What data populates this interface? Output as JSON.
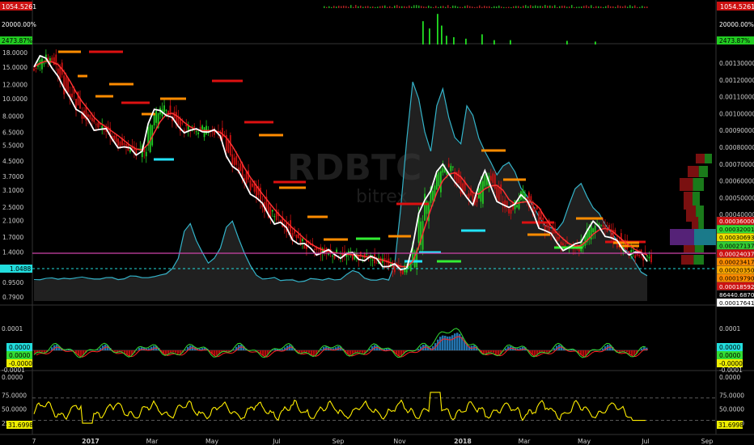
{
  "symbol_watermark": "RDBTC",
  "watermark_sub": "bitrex",
  "colors": {
    "background": "#000000",
    "price_candle_up": "#22cc22",
    "price_candle_down": "#cc1111",
    "sma": "#ffffff",
    "ema": "#ff3333",
    "cyan_line": "#33b3c9",
    "shadow": "#555555",
    "pink_line": "#cc44aa",
    "cyan_dashed": "#22dddd",
    "macd_signal": "#ff2222",
    "macd_line": "#33dd33",
    "rsi_line": "#ffee00",
    "level_red": "#dd1111",
    "level_orange": "#ff8c00",
    "level_cyan": "#22e5ff",
    "level_green": "#33ee33"
  },
  "top_pane": {
    "left_value": "1054.5261",
    "right_value": "1054.5261",
    "left_sub": "20000.00%",
    "right_sub": "20000.00%",
    "left_green": "2473.87%",
    "right_green": "2473.87%"
  },
  "price_axis_left": [
    "18.0000",
    "15.0000",
    "12.0000",
    "10.0000",
    "8.0000",
    "6.5000",
    "5.5000",
    "4.5000",
    "3.7000",
    "3.1000",
    "2.5000",
    "2.1000",
    "1.7000",
    "1.4000",
    "1.1500",
    "0.9500",
    "0.7900"
  ],
  "price_axis_right": [
    "0.00130000",
    "0.00120000",
    "0.00110000",
    "0.00100000",
    "0.00090000",
    "0.00080000",
    "0.00070000",
    "0.00060000",
    "0.00050000",
    "0.00040000"
  ],
  "right_labels": [
    {
      "text": "0.00036000",
      "bg": "#cc1111",
      "fg": "#ffffff"
    },
    {
      "text": "0.00032001",
      "bg": "#33dd33",
      "fg": "#000000"
    },
    {
      "text": "0.00030693",
      "bg": "#eedd00",
      "fg": "#000000"
    },
    {
      "text": "0.00027137",
      "bg": "#33cc33",
      "fg": "#000000"
    },
    {
      "text": "0.00024037",
      "bg": "#cc1111",
      "fg": "#ffffff"
    },
    {
      "text": "0.00023417",
      "bg": "#ff8c00",
      "fg": "#000000"
    },
    {
      "text": "0.00020350",
      "bg": "#ffaa00",
      "fg": "#000000"
    },
    {
      "text": "0.00019790",
      "bg": "#ff8c00",
      "fg": "#000000"
    },
    {
      "text": "0.00018592",
      "bg": "#cc1111",
      "fg": "#ffffff"
    },
    {
      "text": "86440.6870",
      "bg": "#000000",
      "fg": "#ffffff"
    },
    {
      "text": "0.00017641",
      "bg": "#ffffff",
      "fg": "#000000"
    }
  ],
  "left_price_label": "1.0488",
  "macd_pane": {
    "left_ticks": [
      "0.0001",
      "-0.0001",
      "0.0000"
    ],
    "right_ticks": [
      "0.0001",
      "-0.0001",
      "0.0000"
    ],
    "left_badges": [
      {
        "text": "0.0000",
        "bg": "#22dddd"
      },
      {
        "text": "0.0000",
        "bg": "#33dd33"
      },
      {
        "text": "-0.0000",
        "bg": "#eeee00"
      }
    ],
    "right_badges": [
      {
        "text": "0.0000",
        "bg": "#22dddd"
      },
      {
        "text": "0.0000",
        "bg": "#33dd33"
      },
      {
        "text": "-0.0000",
        "bg": "#eeee00"
      }
    ]
  },
  "rsi_pane": {
    "left_ticks": [
      "75.0000",
      "50.0000",
      "25.0000"
    ],
    "right_ticks": [
      "75.0000",
      "50.0000",
      "25.0000"
    ],
    "left_badge": "31.6998",
    "right_badge": "31.6998",
    "upper_band": 70,
    "lower_band": 30
  },
  "time_axis": [
    "7",
    "2017",
    "Mar",
    "May",
    "Jul",
    "Sep",
    "Nov",
    "2018",
    "Mar",
    "May",
    "Jul",
    "Sep"
  ],
  "chart_data": {
    "type": "line",
    "title": "",
    "xlabel": "",
    "ylabel": "",
    "x_range": [
      "2016-11",
      "2018-09"
    ],
    "y_log": true,
    "ylim": [
      0.75,
      19
    ],
    "series": [
      {
        "values": [
          15.0,
          16.5,
          17.0,
          15.5,
          13.0,
          11.0,
          10.5,
          9.0,
          8.0,
          7.5,
          7.0,
          6.8,
          6.5,
          6.0,
          5.6,
          5.3,
          5.1,
          5.0,
          5.3,
          7.0,
          8.5,
          9.0,
          8.2,
          7.5,
          7.0,
          6.8,
          6.6,
          6.5,
          6.7,
          6.8,
          6.5,
          6.0,
          5.0,
          4.3,
          3.8,
          3.4,
          3.1,
          2.8,
          2.5,
          2.3,
          2.1,
          2.0,
          1.85,
          1.7,
          1.6,
          1.5,
          1.45,
          1.42,
          1.4,
          1.38,
          1.37,
          1.36,
          1.35,
          1.34,
          1.32,
          1.3,
          1.28,
          1.26,
          1.22,
          1.18,
          1.15,
          1.12,
          1.2,
          1.5,
          2.2,
          2.8,
          3.2,
          3.8,
          4.2,
          4.0,
          3.5,
          3.0,
          2.8,
          2.7,
          3.3,
          3.8,
          3.3,
          2.8,
          2.5,
          2.4,
          2.7,
          3.0,
          2.6,
          2.3,
          2.0,
          1.85,
          1.7,
          1.6,
          1.5,
          1.45,
          1.5,
          1.65,
          1.9,
          2.0,
          1.9,
          1.8,
          1.7,
          1.55,
          1.45,
          1.42,
          1.38,
          1.33,
          1.28
        ]
      },
      {
        "values": [
          0.97,
          0.98,
          0.99,
          1.0,
          1.0,
          1.0,
          1.01,
          1.0,
          1.0,
          1.0,
          1.0,
          1.0,
          1.01,
          1.01,
          1.0,
          1.0,
          1.02,
          1.02,
          1.01,
          1.01,
          1.02,
          1.05,
          1.08,
          1.15,
          1.3,
          1.8,
          2.0,
          1.6,
          1.4,
          1.2,
          1.3,
          1.5,
          1.9,
          2.1,
          1.7,
          1.4,
          1.2,
          1.05,
          1.0,
          0.98,
          1.0,
          0.97,
          0.98,
          1.0,
          0.96,
          0.98,
          1.0,
          1.0,
          0.99,
          1.0,
          0.98,
          1.0,
          1.05,
          1.1,
          1.08,
          1.02,
          1.0,
          0.98,
          1.0,
          1.0,
          1.2,
          2.5,
          6.0,
          12.5,
          10.0,
          6.5,
          5.0,
          9.0,
          11.5,
          8.0,
          6.0,
          5.5,
          9.0,
          8.0,
          6.0,
          5.0,
          4.5,
          3.8,
          4.2,
          4.5,
          3.9,
          3.2,
          2.9,
          2.5,
          2.2,
          2.0,
          1.9,
          1.85,
          2.1,
          2.6,
          3.2,
          3.4,
          2.9,
          2.5,
          2.3,
          2.0,
          1.8,
          1.6,
          1.5,
          1.4,
          1.25,
          1.1,
          1.05
        ]
      }
    ]
  }
}
